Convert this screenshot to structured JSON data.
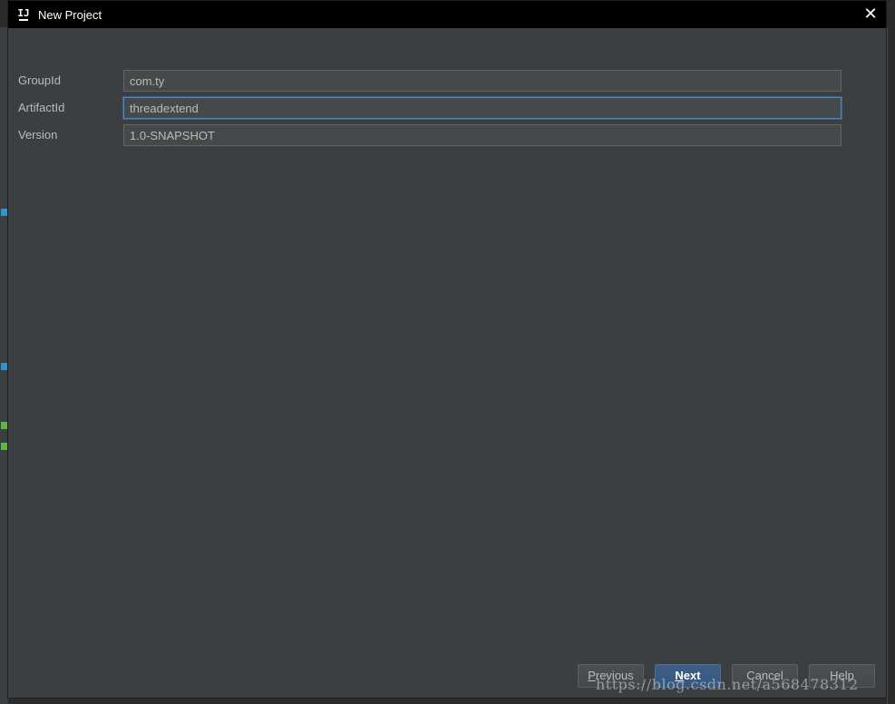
{
  "window": {
    "title": "New Project",
    "close_glyph": "✕"
  },
  "form": {
    "fields": [
      {
        "label": "GroupId",
        "value": "com.ty"
      },
      {
        "label": "ArtifactId",
        "value": "threadextend"
      },
      {
        "label": "Version",
        "value": "1.0-SNAPSHOT"
      }
    ]
  },
  "buttons": {
    "previous": {
      "mnemonic": "P",
      "rest": "revious"
    },
    "next": {
      "mnemonic": "N",
      "rest": "ext"
    },
    "cancel": {
      "label": "Cancel"
    },
    "help": {
      "label": "Help"
    }
  },
  "watermark": "https://blog.csdn.net/a568478312",
  "colors": {
    "dialog_bg": "#3c3f41",
    "titlebar_bg": "#000000",
    "field_bg": "#45494a",
    "focus_border": "#4a88c7",
    "primary_button": "#365880"
  }
}
